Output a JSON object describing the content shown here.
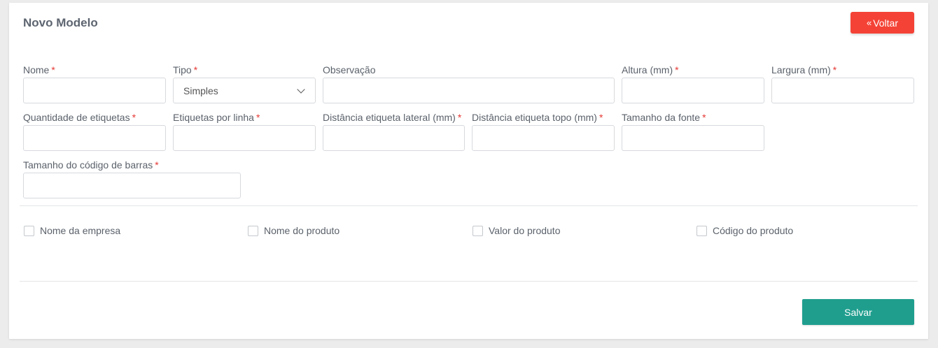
{
  "header": {
    "title": "Novo Modelo",
    "back_label": "Voltar",
    "back_icon": "«"
  },
  "fields": {
    "nome": {
      "label": "Nome",
      "value": ""
    },
    "tipo": {
      "label": "Tipo",
      "value": "Simples"
    },
    "observacao": {
      "label": "Observação",
      "value": ""
    },
    "altura": {
      "label": "Altura (mm)",
      "value": ""
    },
    "largura": {
      "label": "Largura (mm)",
      "value": ""
    },
    "quantidade": {
      "label": "Quantidade de etiquetas",
      "value": ""
    },
    "por_linha": {
      "label": "Etiquetas por linha",
      "value": ""
    },
    "dist_lateral": {
      "label": "Distância etiqueta lateral (mm)",
      "value": ""
    },
    "dist_topo": {
      "label": "Distância etiqueta topo (mm)",
      "value": ""
    },
    "fonte": {
      "label": "Tamanho da fonte",
      "value": ""
    },
    "codigo_barras": {
      "label": "Tamanho do código de barras",
      "value": ""
    }
  },
  "required_mark": "*",
  "checkboxes": [
    {
      "label": "Nome da empresa",
      "checked": false
    },
    {
      "label": "Nome do produto",
      "checked": false
    },
    {
      "label": "Valor do produto",
      "checked": false
    },
    {
      "label": "Código do produto",
      "checked": false
    }
  ],
  "footer": {
    "save_label": "Salvar"
  },
  "colors": {
    "back_button": "#f44336",
    "save_button": "#1f9e8e",
    "required": "#e53935"
  }
}
